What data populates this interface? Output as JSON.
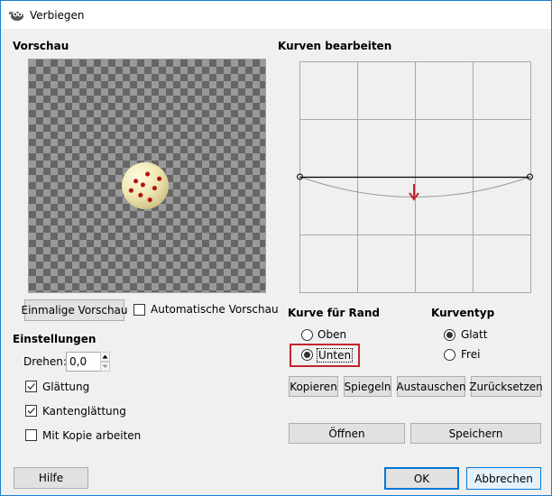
{
  "window": {
    "title": "Verbiegen",
    "icon": "gimp-icon"
  },
  "preview": {
    "heading": "Vorschau",
    "once_button": "Einmalige Vorschau",
    "auto_label": "Automatische Vorschau",
    "auto_checked": false
  },
  "settings": {
    "heading": "Einstellungen",
    "rotate_label": "Drehen:",
    "rotate_value": "0,0",
    "smoothing_label": "Glättung",
    "smoothing_checked": true,
    "antialias_label": "Kantenglättung",
    "antialias_checked": true,
    "copy_label": "Mit Kopie arbeiten",
    "copy_checked": false
  },
  "curve": {
    "heading": "Kurven bearbeiten",
    "edge_heading": "Kurve für Rand",
    "edge_options": [
      "Oben",
      "Unten"
    ],
    "edge_selected": "Unten",
    "type_heading": "Kurventyp",
    "type_options": [
      "Glatt",
      "Frei"
    ],
    "type_selected": "Glatt",
    "annotation_color": "#c0272d"
  },
  "buttons": {
    "copy": "Kopieren",
    "mirror": "Spiegeln",
    "swap": "Austauschen",
    "reset": "Zurücksetzen",
    "open": "Öffnen",
    "save": "Speichern",
    "help": "Hilfe",
    "ok": "OK",
    "cancel": "Abbrechen"
  }
}
